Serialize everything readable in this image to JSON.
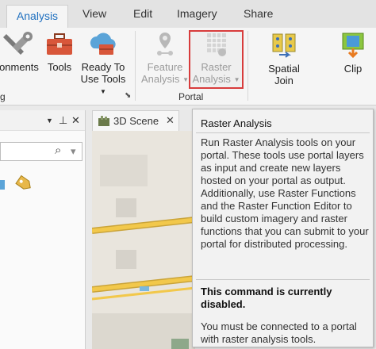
{
  "tabs": [
    {
      "label": "Analysis",
      "active": true
    },
    {
      "label": "View"
    },
    {
      "label": "Edit"
    },
    {
      "label": "Imagery"
    },
    {
      "label": "Share"
    }
  ],
  "ribbon": {
    "environments_label": "onments",
    "tools_label": "Tools",
    "ready_to_use_line1": "Ready To",
    "ready_to_use_line2": "Use Tools",
    "feature_analysis_line1": "Feature",
    "feature_analysis_line2": "Analysis",
    "raster_analysis_line1": "Raster",
    "raster_analysis_line2": "Analysis",
    "spatial_join_line1": "Spatial",
    "spatial_join_line2": "Join",
    "clip_label": "Clip",
    "group_geoprocessing_fragment": "g",
    "group_portal": "Portal",
    "launcher_glyph": "⬊"
  },
  "left_pane": {
    "pin_glyph": "▼",
    "pin2_glyph": "⊥",
    "close_glyph": "✕",
    "search_glyph": "⌕",
    "dropdown_glyph": "▾"
  },
  "map_tab": {
    "label": "3D Scene",
    "close_glyph": "✕"
  },
  "tooltip": {
    "title": "Raster Analysis",
    "body": "Run Raster Analysis tools on your portal. These tools use portal layers as input and create new layers hosted on your portal as output. Additionally, use Raster Functions and the Raster Function Editor to build custom imagery and raster functions that you can submit to your portal for distributed processing.",
    "disabled_heading": "This command is currently disabled.",
    "disabled_reason": "You must be connected to a portal with raster analysis tools."
  },
  "colors": {
    "accent": "#1e6fbf",
    "highlight": "#d83c3c",
    "road": "#f2c84b"
  }
}
